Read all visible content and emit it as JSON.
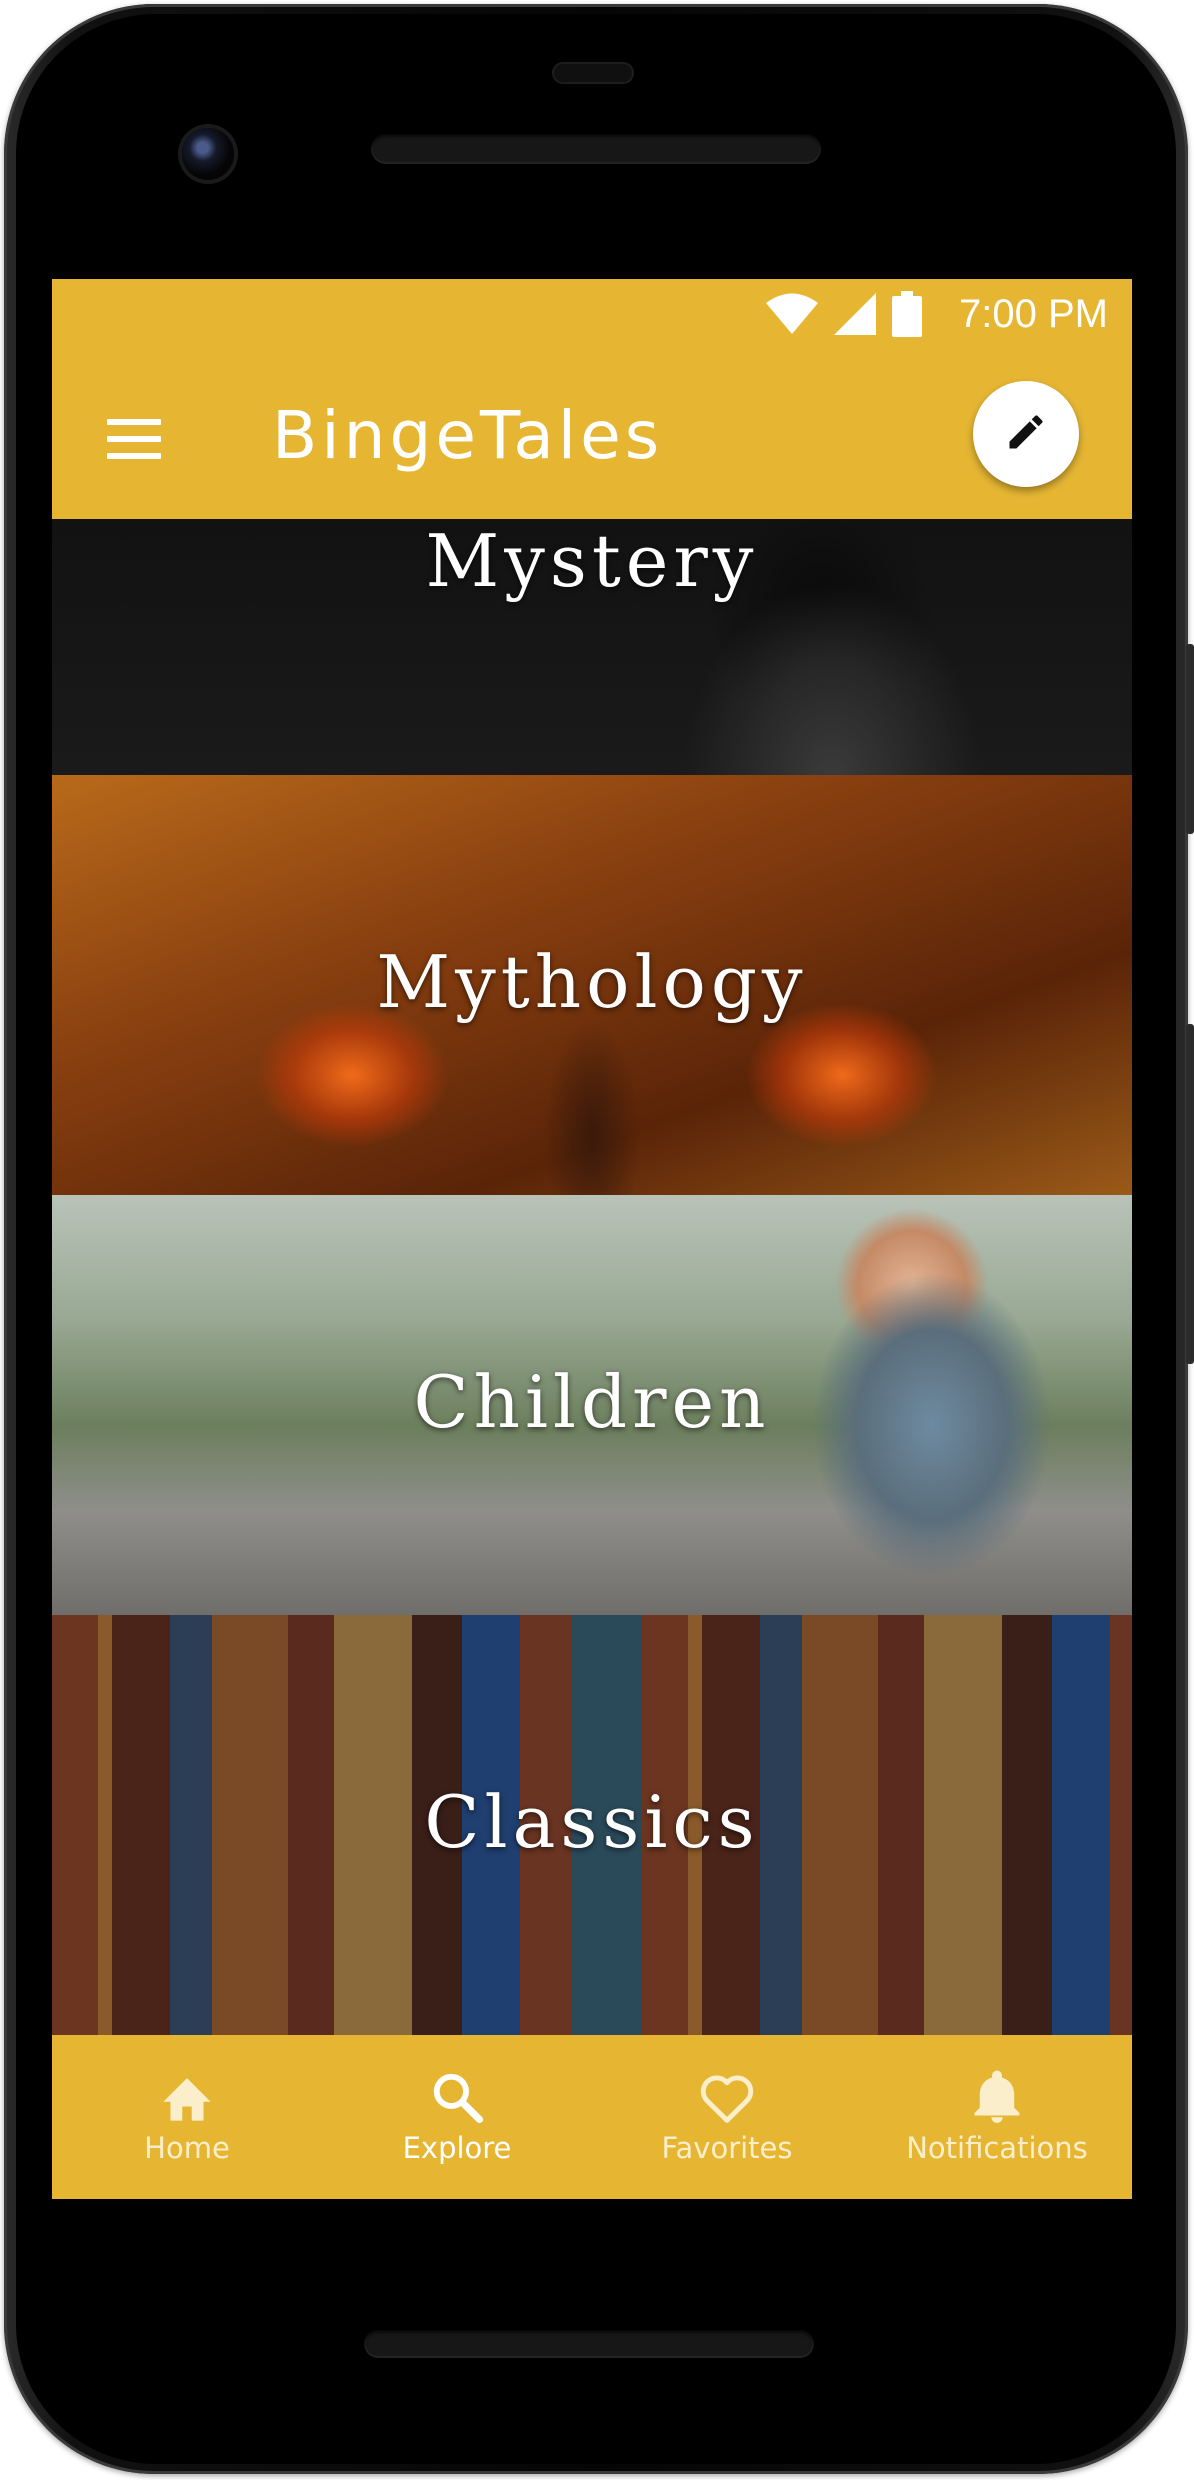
{
  "status_bar": {
    "time": "7:00 PM",
    "icons": [
      "wifi-icon",
      "signal-icon",
      "battery-icon"
    ]
  },
  "app_bar": {
    "title": "BingeTales",
    "menu_icon": "hamburger-menu-icon",
    "action_icon": "pencil-edit-icon",
    "background_color": "#e6b633"
  },
  "categories": [
    {
      "label": "Mystery",
      "image": "hooded-figure-photo"
    },
    {
      "label": "Mythology",
      "image": "winged-demon-painting"
    },
    {
      "label": "Children",
      "image": "laughing-child-photo"
    },
    {
      "label": "Classics",
      "image": "antique-books-photo"
    }
  ],
  "bottom_nav": {
    "active": "Explore",
    "items": [
      {
        "label": "Home",
        "icon": "home-icon"
      },
      {
        "label": "Explore",
        "icon": "search-icon"
      },
      {
        "label": "Favorites",
        "icon": "heart-icon"
      },
      {
        "label": "Notifications",
        "icon": "bell-icon"
      }
    ]
  }
}
